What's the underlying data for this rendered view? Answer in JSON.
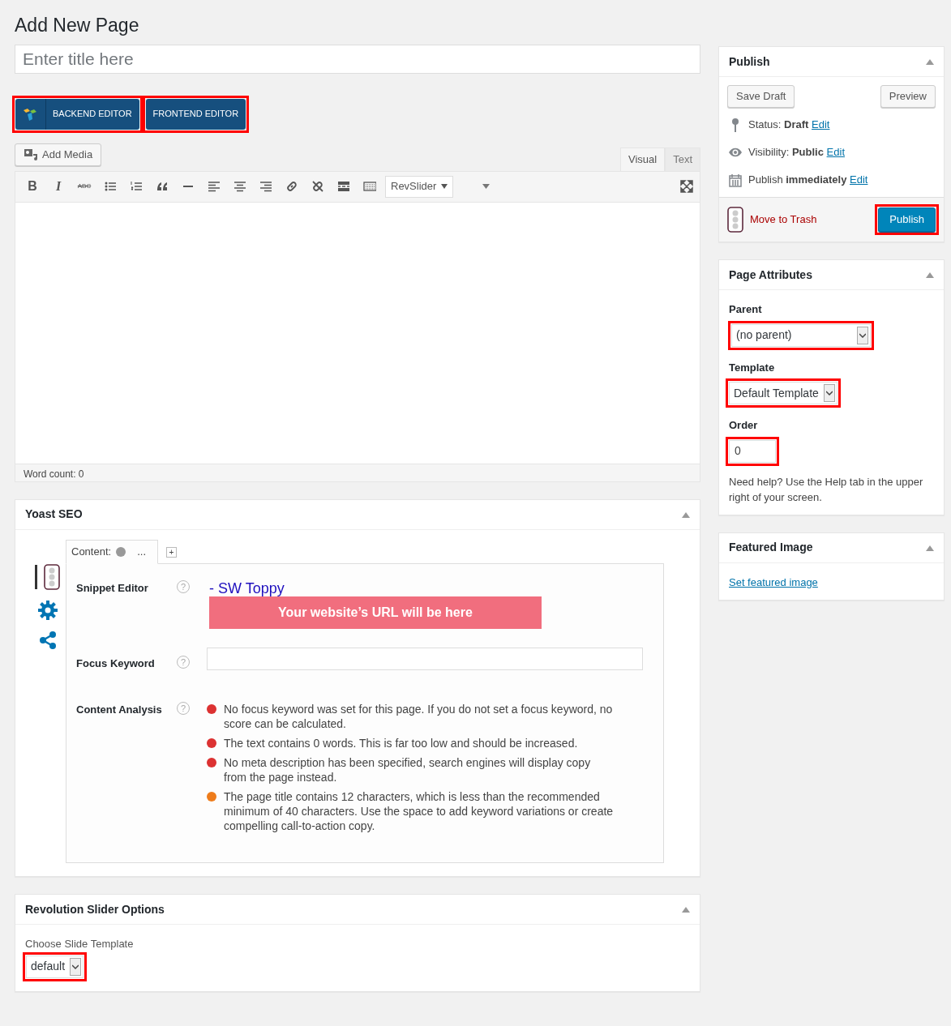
{
  "page_title": "Add New Page",
  "title_field": {
    "placeholder": "Enter title here"
  },
  "editor_switch": [
    {
      "label": "BACKEND EDITOR",
      "kind": "logo",
      "highlighted": true
    },
    {
      "label": "FRONTEND EDITOR",
      "kind": "plain",
      "highlighted": true
    }
  ],
  "add_media": "Add Media",
  "editor_tabs": [
    {
      "label": "Visual",
      "selected": true
    },
    {
      "label": "Text",
      "selected": false
    }
  ],
  "toolbar": {
    "text_buttons": [
      {
        "label": "B",
        "kind": "bold"
      },
      {
        "label": "I",
        "kind": "italic"
      },
      {
        "label": "ABC",
        "kind": "strike"
      }
    ],
    "dropdown": "RevSlider"
  },
  "word_count": "Word count: 0",
  "yoast": {
    "title": "Yoast SEO",
    "side_tabs": [
      {
        "kind": "traffic",
        "selected": true
      },
      {
        "kind": "gear",
        "selected": false
      },
      {
        "kind": "share",
        "selected": false
      }
    ],
    "tab_label": "Content:",
    "tab_more": "...",
    "add_tab": "+",
    "snippet": {
      "label": "Snippet Editor",
      "help": "?",
      "title": "- SW Toppy",
      "url_banner": "Your website’s URL will be here"
    },
    "focus_keyword": {
      "label": "Focus Keyword",
      "help": "?"
    },
    "content_analysis": {
      "label": "Content Analysis",
      "help": "?",
      "items": [
        {
          "text": "No focus keyword was set for this page. If you do not set a focus keyword, no score can be calculated.",
          "color": "#dc3232"
        },
        {
          "text": "The text contains 0 words. This is far too low and should be increased.",
          "color": "#dc3232"
        },
        {
          "text": "No meta description has been specified, search engines will display copy from the page instead.",
          "color": "#dc3232"
        },
        {
          "text": "The page title contains 12 characters, which is less than the recommended minimum of 40 characters. Use the space to add keyword variations or create compelling call-to-action copy.",
          "color": "#ee7c1b"
        }
      ]
    }
  },
  "revolution": {
    "title": "Revolution Slider Options",
    "label": "Choose Slide Template",
    "select": {
      "value": "default",
      "highlighted": true
    }
  },
  "publish": {
    "title": "Publish",
    "save_draft": "Save Draft",
    "preview": "Preview",
    "meta": [
      {
        "kind": "status",
        "label": "Status:",
        "value": "Draft",
        "link": "Edit"
      },
      {
        "kind": "visibility",
        "label": "Visibility:",
        "value": "Public",
        "link": "Edit"
      },
      {
        "kind": "schedule",
        "label": "Publish",
        "value": "immediately",
        "link": "Edit"
      }
    ],
    "trash": "Move to Trash",
    "button": {
      "label": "Publish",
      "highlighted": true
    }
  },
  "page_attributes": {
    "title": "Page Attributes",
    "parent": {
      "label": "Parent",
      "value": "(no parent)",
      "highlighted": true
    },
    "template": {
      "label": "Template",
      "value": "Default Template",
      "highlighted": true
    },
    "order": {
      "label": "Order",
      "value": "0",
      "highlighted": true
    },
    "help": "Need help? Use the Help tab in the upper right of your screen."
  },
  "featured_image": {
    "title": "Featured Image",
    "link": "Set featured image"
  }
}
